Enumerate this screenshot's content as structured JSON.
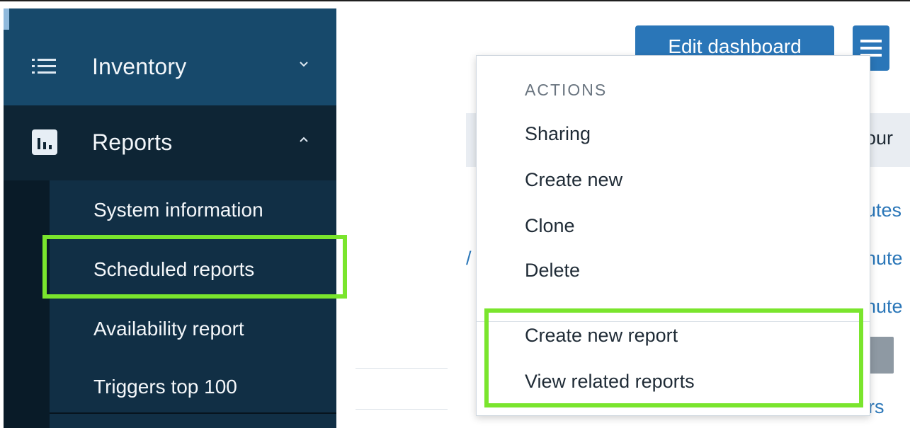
{
  "sidebar": {
    "inventory": {
      "label": "Inventory",
      "icon": "list-icon",
      "chevron": "chevron-down-icon"
    },
    "reports": {
      "label": "Reports",
      "icon": "bar-chart-icon",
      "chevron": "chevron-up-icon"
    },
    "submenu": [
      {
        "label": "System information"
      },
      {
        "label": "Scheduled reports",
        "highlighted": true
      },
      {
        "label": "Availability report"
      },
      {
        "label": "Triggers top 100"
      }
    ]
  },
  "header": {
    "edit_dashboard": "Edit dashboard",
    "menu_icon": "hamburger-icon"
  },
  "dropdown": {
    "section_title": "ACTIONS",
    "items": [
      "Sharing",
      "Create new",
      "Clone",
      "Delete"
    ],
    "report_items": [
      "Create new report",
      "View related reports"
    ]
  },
  "background_fragments": {
    "our": "our",
    "utes": "utes",
    "nute1": "nute",
    "nute2": "nute",
    "rs": "rs",
    "slash": "/"
  },
  "colors": {
    "highlight": "#7ae52d",
    "accent": "#2a76b8",
    "sidebar": "#0f2b40"
  }
}
